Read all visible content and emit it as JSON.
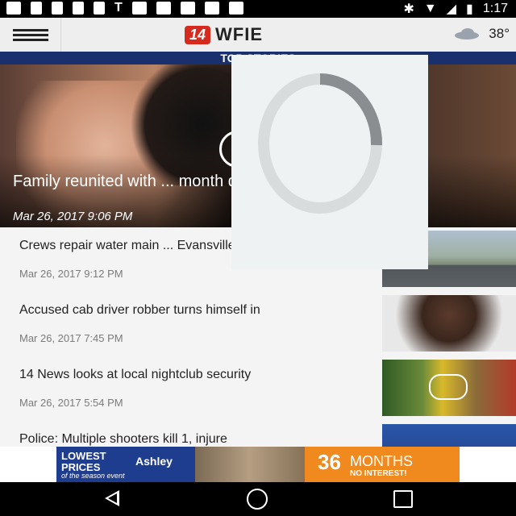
{
  "status_bar": {
    "time": "1:17",
    "letter": "T"
  },
  "app_bar": {
    "logo_badge": "14",
    "logo_name": "WFIE",
    "temperature": "38°"
  },
  "section": {
    "label": "TOP STORIES"
  },
  "hero": {
    "title": "Family reunited with ... month disappearance",
    "date": "Mar 26, 2017 9:06 PM"
  },
  "stories": [
    {
      "title": "Crews repair water main ... Evansville",
      "date": "Mar 26, 2017 9:12 PM"
    },
    {
      "title": "Accused cab driver robber turns himself in",
      "date": "Mar 26, 2017 7:45 PM"
    },
    {
      "title": "14 News looks at local nightclub security",
      "date": "Mar 26, 2017 5:54 PM"
    },
    {
      "title": "Police: Multiple shooters kill 1, injure",
      "date": ""
    }
  ],
  "ad": {
    "line1": "LOWEST",
    "line2": "PRICES",
    "line3": "of the season event",
    "brand": "Ashley",
    "months_number": "36",
    "months_text": "MONTHS",
    "months_sub": "NO INTEREST!"
  },
  "colors": {
    "banner": "#1a2f6e",
    "logo_red": "#d62a1e",
    "ad_orange": "#f08a1f"
  },
  "icons": [
    "menu-icon",
    "weather-cloud-icon",
    "play-icon",
    "back-icon",
    "home-icon",
    "recents-icon",
    "loading-spinner-icon"
  ]
}
